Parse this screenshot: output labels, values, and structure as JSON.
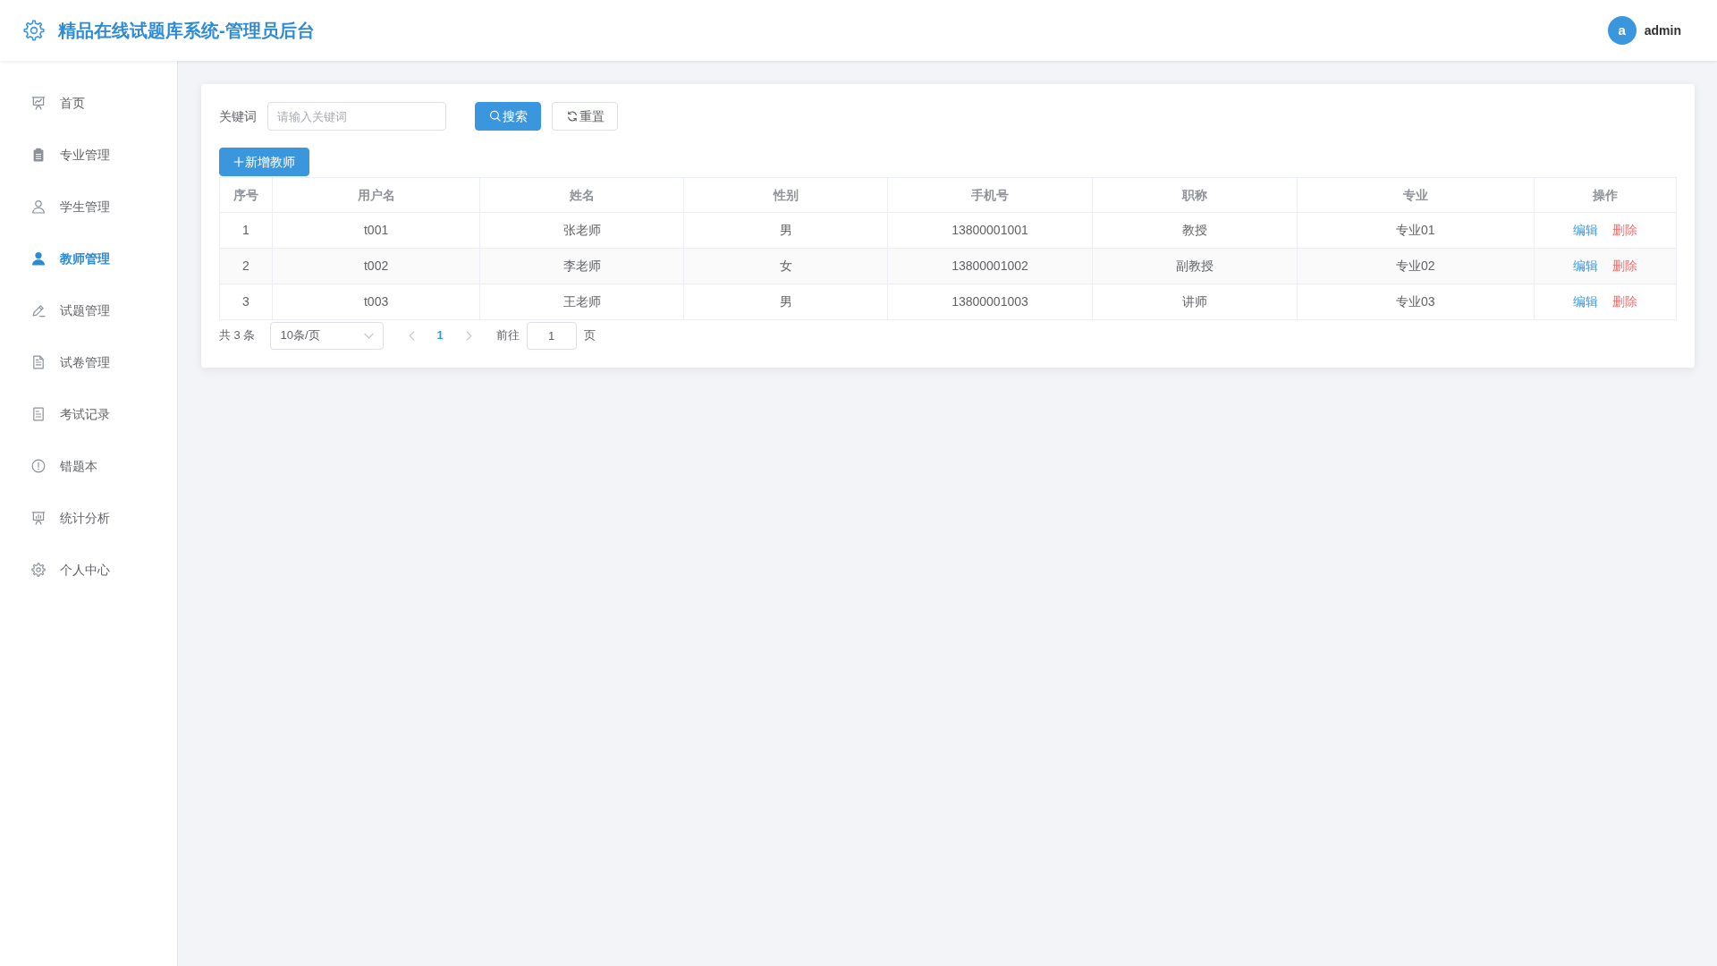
{
  "header": {
    "title": "精品在线试题库系统-管理员后台",
    "user": {
      "avatar_letter": "a",
      "name": "admin"
    }
  },
  "sidebar": {
    "items": [
      {
        "label": "首页",
        "selected": false
      },
      {
        "label": "专业管理",
        "selected": false
      },
      {
        "label": "学生管理",
        "selected": false
      },
      {
        "label": "教师管理",
        "selected": true
      },
      {
        "label": "试题管理",
        "selected": false
      },
      {
        "label": "试卷管理",
        "selected": false
      },
      {
        "label": "考试记录",
        "selected": false
      },
      {
        "label": "错题本",
        "selected": false
      },
      {
        "label": "统计分析",
        "selected": false
      },
      {
        "label": "个人中心",
        "selected": false
      }
    ]
  },
  "search": {
    "label": "关键词",
    "placeholder": "请输入关键词",
    "buttons": [
      {
        "label": "搜索",
        "kind": "primary"
      },
      {
        "label": "重置",
        "kind": "default"
      }
    ]
  },
  "toolbar": {
    "buttons": [
      {
        "label": "新增教师",
        "kind": "primary"
      }
    ]
  },
  "table": {
    "columns": [
      "序号",
      "用户名",
      "姓名",
      "性别",
      "手机号",
      "职称",
      "专业",
      "操作"
    ],
    "rows": [
      {
        "cells": [
          "1",
          "t001",
          "张老师",
          "男",
          "13800001001",
          "教授",
          "专业01"
        ],
        "actions": [
          {
            "label": "编辑",
            "kind": "edit"
          },
          {
            "label": "删除",
            "kind": "delete"
          }
        ]
      },
      {
        "cells": [
          "2",
          "t002",
          "李老师",
          "女",
          "13800001002",
          "副教授",
          "专业02"
        ],
        "actions": [
          {
            "label": "编辑",
            "kind": "edit"
          },
          {
            "label": "删除",
            "kind": "delete"
          }
        ]
      },
      {
        "cells": [
          "3",
          "t003",
          "王老师",
          "男",
          "13800001003",
          "讲师",
          "专业03"
        ],
        "actions": [
          {
            "label": "编辑",
            "kind": "edit"
          },
          {
            "label": "删除",
            "kind": "delete"
          }
        ]
      }
    ]
  },
  "pagination": {
    "total": "共 3 条",
    "page_size": "10条/页",
    "prev": {
      "disabled": true
    },
    "pages": [
      {
        "label": "1",
        "selected": true
      }
    ],
    "next": {
      "disabled": true
    },
    "goto_label": "前往",
    "goto_value": "1",
    "goto_suffix": "页"
  }
}
